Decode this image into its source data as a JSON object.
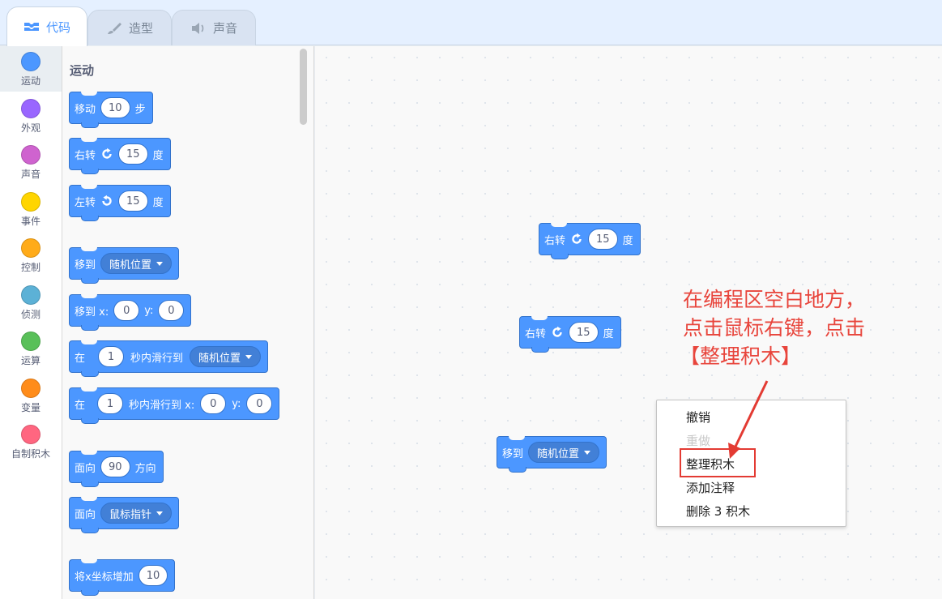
{
  "tabs": [
    {
      "label": "代码",
      "icon": "code-icon",
      "active": true
    },
    {
      "label": "造型",
      "icon": "brush-icon",
      "active": false
    },
    {
      "label": "声音",
      "icon": "speaker-icon",
      "active": false
    }
  ],
  "categories": [
    {
      "label": "运动",
      "color": "#4c97ff"
    },
    {
      "label": "外观",
      "color": "#9966ff"
    },
    {
      "label": "声音",
      "color": "#cf63cf"
    },
    {
      "label": "事件",
      "color": "#ffd500"
    },
    {
      "label": "控制",
      "color": "#ffab19"
    },
    {
      "label": "侦测",
      "color": "#5cb1d6"
    },
    {
      "label": "运算",
      "color": "#59c059"
    },
    {
      "label": "变量",
      "color": "#ff8c1a"
    },
    {
      "label": "自制积木",
      "color": "#ff6680"
    }
  ],
  "palette": {
    "section_title": "运动",
    "blocks": {
      "move": {
        "text": "移动",
        "value": "10",
        "unit": "步"
      },
      "turn_right": {
        "text": "右转",
        "value": "15",
        "unit": "度"
      },
      "turn_left": {
        "text": "左转",
        "value": "15",
        "unit": "度"
      },
      "goto": {
        "text": "移到",
        "option": "随机位置"
      },
      "goto_xy": {
        "text": "移到 x:",
        "x": "0",
        "y_label": "y:",
        "y": "0"
      },
      "glide_to": {
        "prefix": "在",
        "secs": "1",
        "mid": "秒内滑行到",
        "option": "随机位置"
      },
      "glide_xy": {
        "prefix": "在",
        "secs": "1",
        "mid": "秒内滑行到 x:",
        "x": "0",
        "y_label": "y:",
        "y": "0"
      },
      "point_dir": {
        "text": "面向",
        "value": "90",
        "unit": "方向"
      },
      "point_towards": {
        "text": "面向",
        "option": "鼠标指针"
      },
      "change_x": {
        "text": "将x坐标增加",
        "value": "10"
      }
    }
  },
  "workspace": {
    "blocks": {
      "turn1": {
        "text": "右转",
        "value": "15",
        "unit": "度"
      },
      "turn2": {
        "text": "右转",
        "value": "15",
        "unit": "度"
      },
      "goto": {
        "text": "移到",
        "option": "随机位置"
      }
    }
  },
  "annotation": {
    "line1": "在编程区空白地方，",
    "line2": "点击鼠标右键，点击",
    "line3": "【整理积木】",
    "color": "#e8453c"
  },
  "context_menu": {
    "items": [
      {
        "label": "撤销",
        "enabled": true
      },
      {
        "label": "重做",
        "enabled": false
      },
      {
        "label": "整理积木",
        "enabled": true
      },
      {
        "label": "添加注释",
        "enabled": true
      },
      {
        "label": "删除 3 积木",
        "enabled": true
      }
    ]
  }
}
